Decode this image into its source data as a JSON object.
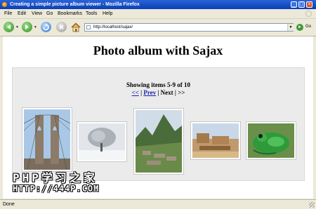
{
  "window": {
    "title": "Creating a simple picture album viewer - Mozilla Firefox"
  },
  "menu": [
    "File",
    "Edit",
    "View",
    "Go",
    "Bookmarks",
    "Tools",
    "Help"
  ],
  "toolbar": {
    "url": "http://localhost/sajax/",
    "go_label": "Go"
  },
  "page": {
    "heading": "Photo album with Sajax",
    "showing": "Showing items 5-9 of 10",
    "pager": {
      "first": "<<",
      "prev": "Prev",
      "sep": " | ",
      "next": "Next",
      "last": ">>"
    },
    "thumbnails": [
      "bridge-photo",
      "snowy-tree-photo",
      "mountain-ruins-photo",
      "desert-ruins-photo",
      "frog-photo"
    ]
  },
  "watermark": {
    "line1": "PHP学习之家",
    "line2": "HTTP://444P.COM"
  },
  "status": {
    "text": "Done"
  },
  "colors": {
    "titlebar": "#0a3fb5",
    "link": "#1a1ab8",
    "album_bg": "#ebebeb"
  }
}
